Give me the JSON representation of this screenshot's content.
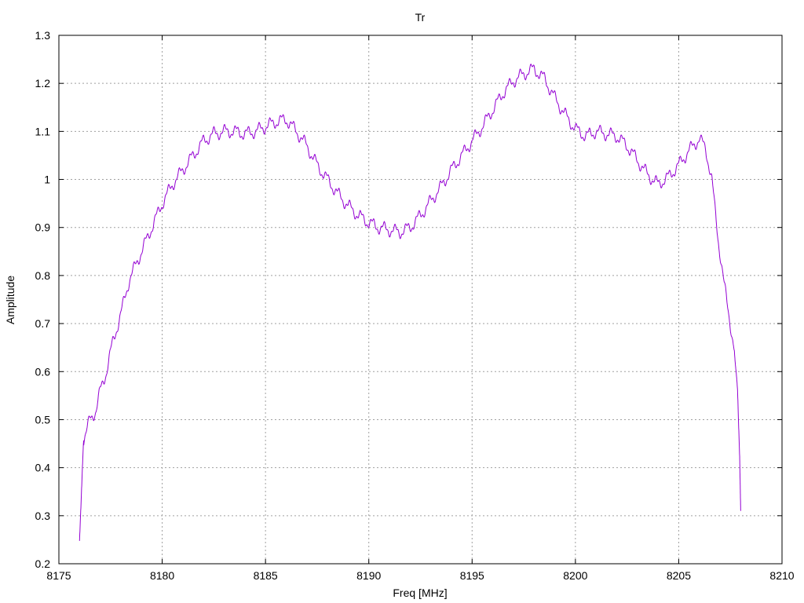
{
  "chart_data": {
    "type": "line",
    "title": "Tr",
    "xlabel": "Freq [MHz]",
    "ylabel": "Amplitude",
    "xlim": [
      8175,
      8210
    ],
    "ylim": [
      0.2,
      1.3
    ],
    "x_ticks": [
      8175,
      8180,
      8185,
      8190,
      8195,
      8200,
      8205,
      8210
    ],
    "x_tick_labels": [
      "8175",
      "8180",
      "8185",
      "8190",
      "8195",
      "8200",
      "8205",
      "8210"
    ],
    "y_ticks": [
      0.2,
      0.3,
      0.4,
      0.5,
      0.6,
      0.7,
      0.8,
      0.9,
      1.0,
      1.1,
      1.2,
      1.3
    ],
    "y_tick_labels": [
      "0.2",
      "0.3",
      "0.4",
      "0.5",
      "0.6",
      "0.7",
      "0.8",
      "0.9",
      "1",
      "1.1",
      "1.2",
      "1.3"
    ],
    "grid": true,
    "series": [
      {
        "color": "#9400d3",
        "x": [
          8176.0,
          8176.1,
          8176.2,
          8176.3,
          8176.5,
          8176.8,
          8177.0,
          8177.3,
          8177.6,
          8178.0,
          8178.4,
          8178.8,
          8179.2,
          8179.6,
          8180.0,
          8180.5,
          8181.0,
          8181.5,
          8182.0,
          8182.5,
          8183.0,
          8183.5,
          8184.0,
          8184.5,
          8185.0,
          8185.5,
          8186.0,
          8186.5,
          8187.0,
          8187.5,
          8188.0,
          8188.5,
          8189.0,
          8189.5,
          8190.0,
          8190.5,
          8191.0,
          8191.5,
          8192.0,
          8192.5,
          8193.0,
          8193.5,
          8194.0,
          8194.5,
          8195.0,
          8195.5,
          8196.0,
          8196.5,
          8197.0,
          8197.5,
          8198.0,
          8198.5,
          8199.0,
          8199.5,
          8200.0,
          8200.5,
          8201.0,
          8201.5,
          8202.0,
          8202.5,
          8203.0,
          8203.5,
          8204.0,
          8204.5,
          8205.0,
          8205.5,
          8206.0,
          8206.3,
          8206.6,
          8206.9,
          8207.2,
          8207.5,
          8207.7,
          8207.85,
          8207.95,
          8208.0
        ],
        "y": [
          0.245,
          0.36,
          0.46,
          0.47,
          0.5,
          0.52,
          0.56,
          0.6,
          0.66,
          0.72,
          0.79,
          0.83,
          0.87,
          0.91,
          0.95,
          0.99,
          1.02,
          1.05,
          1.08,
          1.095,
          1.1,
          1.1,
          1.095,
          1.1,
          1.11,
          1.12,
          1.125,
          1.1,
          1.07,
          1.03,
          1.0,
          0.97,
          0.945,
          0.925,
          0.91,
          0.9,
          0.895,
          0.89,
          0.9,
          0.925,
          0.955,
          0.985,
          1.02,
          1.05,
          1.08,
          1.11,
          1.145,
          1.18,
          1.205,
          1.22,
          1.23,
          1.21,
          1.17,
          1.135,
          1.105,
          1.09,
          1.1,
          1.095,
          1.09,
          1.07,
          1.04,
          1.01,
          0.99,
          1.005,
          1.03,
          1.06,
          1.085,
          1.065,
          1.0,
          0.88,
          0.78,
          0.7,
          0.64,
          0.56,
          0.42,
          0.31
        ]
      }
    ]
  }
}
